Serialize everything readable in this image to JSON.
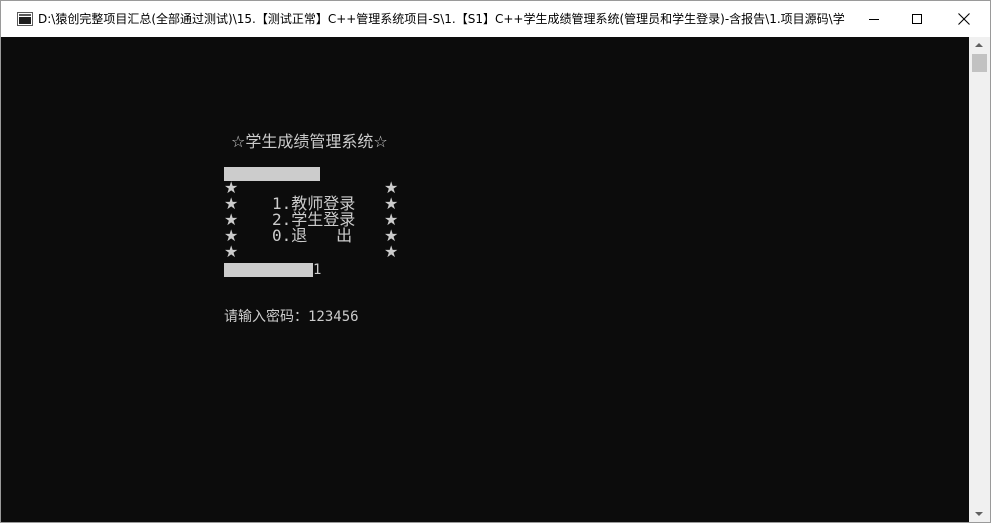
{
  "window": {
    "title": "D:\\猿创完整项目汇总(全部通过测试)\\15.【测试正常】C++管理系统项目-S\\1.【S1】C++学生成绩管理系统(管理员和学生登录)-含报告\\1.项目源码\\学...",
    "minimize_label": "minimize",
    "maximize_label": "maximize",
    "close_label": "close"
  },
  "console": {
    "banner": "☆学生成绩管理系统☆",
    "menu": {
      "item1": "1.教师登录",
      "item2": "2.学生登录",
      "item0": "0.退   出",
      "star": "★"
    },
    "choice_input": "1",
    "prompt_label": "请输入密码：",
    "prompt_value": "123456"
  }
}
